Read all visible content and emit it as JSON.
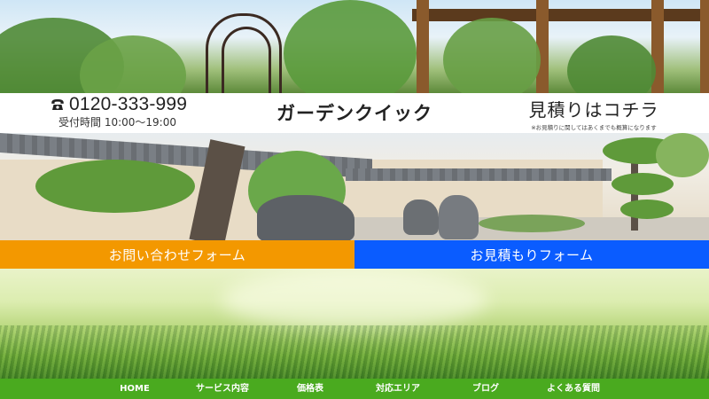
{
  "header": {
    "phone": "0120-333-999",
    "hours": "受付時間 10:00〜19:00",
    "brand": "ガーデンクイック",
    "estimate_title": "見積りはコチラ",
    "estimate_note": "※お見積りに関してはあくまでも概算になります"
  },
  "buttons": {
    "contact": "お問い合わせフォーム",
    "estimate": "お見積もりフォーム"
  },
  "nav": {
    "items": [
      "HOME",
      "サービス内容",
      "価格表",
      "対応エリア",
      "ブログ",
      "よくある質問"
    ]
  },
  "colors": {
    "contact_button": "#f39800",
    "estimate_button": "#0a5cff",
    "nav_bar": "#4aaa1f"
  },
  "icons": {
    "phone": "phone-icon"
  }
}
